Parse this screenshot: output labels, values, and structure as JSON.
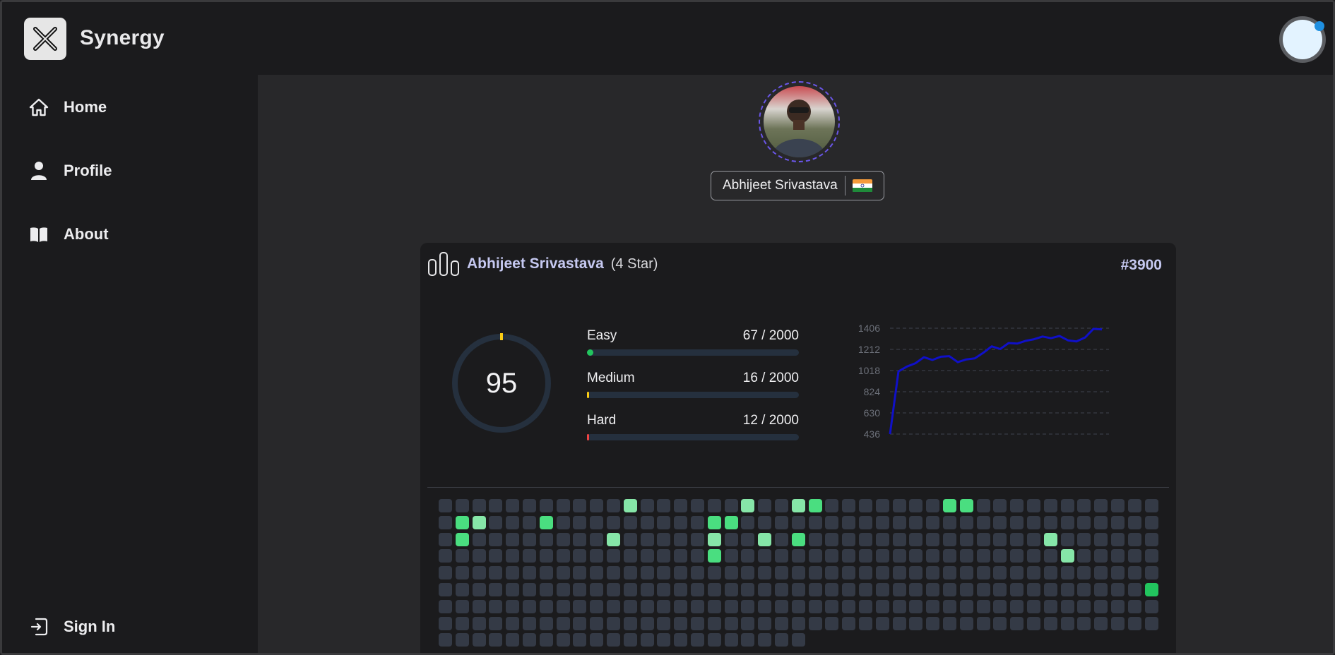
{
  "app": {
    "name": "Synergy"
  },
  "sidebar": {
    "items": [
      {
        "label": "Home",
        "icon": "home-icon"
      },
      {
        "label": "Profile",
        "icon": "user-icon"
      },
      {
        "label": "About",
        "icon": "book-icon"
      }
    ],
    "signin_label": "Sign In"
  },
  "profile": {
    "name": "Abhijeet Srivastava",
    "country_flag": "india-flag-icon"
  },
  "card": {
    "user": "Abhijeet Srivastava",
    "stars": "(4 Star)",
    "rank": "#3900",
    "solved": "95",
    "difficulties": [
      {
        "label": "Easy",
        "value": "67 / 2000",
        "solved": 67,
        "total": 2000,
        "color": "#22c55e"
      },
      {
        "label": "Medium",
        "value": "16 / 2000",
        "solved": 16,
        "total": 2000,
        "color": "#facc15"
      },
      {
        "label": "Hard",
        "value": "12 / 2000",
        "solved": 12,
        "total": 2000,
        "color": "#ef4444"
      }
    ]
  },
  "colors": {
    "accent": "#6a56e8",
    "line": "#1010c8",
    "cell_empty": "#343a46",
    "cell_light": "#86e6a8",
    "cell_mid": "#4ade80",
    "cell_dark": "#22c55e"
  },
  "chart_data": {
    "type": "line",
    "y_ticks": [
      "1406",
      "1212",
      "1018",
      "824",
      "630",
      "436"
    ],
    "ylim": [
      436,
      1406
    ],
    "grid": true,
    "series": [
      {
        "values": [
          436,
          1010,
          1055,
          1085,
          1140,
          1115,
          1145,
          1150,
          1095,
          1120,
          1130,
          1180,
          1240,
          1215,
          1270,
          1265,
          1290,
          1305,
          1330,
          1315,
          1335,
          1295,
          1285,
          1320,
          1400,
          1395
        ]
      }
    ]
  },
  "heatmap": {
    "columns": 43,
    "rows": 9,
    "last_row_count": 22,
    "highlights": [
      {
        "r": 0,
        "c": 11,
        "level": "light"
      },
      {
        "r": 0,
        "c": 18,
        "level": "light"
      },
      {
        "r": 0,
        "c": 21,
        "level": "light"
      },
      {
        "r": 0,
        "c": 22,
        "level": "mid"
      },
      {
        "r": 0,
        "c": 30,
        "level": "mid"
      },
      {
        "r": 0,
        "c": 31,
        "level": "mid"
      },
      {
        "r": 1,
        "c": 1,
        "level": "mid"
      },
      {
        "r": 1,
        "c": 2,
        "level": "light"
      },
      {
        "r": 1,
        "c": 6,
        "level": "mid"
      },
      {
        "r": 1,
        "c": 16,
        "level": "mid"
      },
      {
        "r": 1,
        "c": 17,
        "level": "mid"
      },
      {
        "r": 2,
        "c": 1,
        "level": "mid"
      },
      {
        "r": 2,
        "c": 10,
        "level": "light"
      },
      {
        "r": 2,
        "c": 16,
        "level": "light"
      },
      {
        "r": 2,
        "c": 19,
        "level": "light"
      },
      {
        "r": 2,
        "c": 21,
        "level": "mid"
      },
      {
        "r": 2,
        "c": 36,
        "level": "light"
      },
      {
        "r": 3,
        "c": 16,
        "level": "mid"
      },
      {
        "r": 3,
        "c": 37,
        "level": "light"
      },
      {
        "r": 5,
        "c": 42,
        "level": "dark"
      }
    ]
  }
}
